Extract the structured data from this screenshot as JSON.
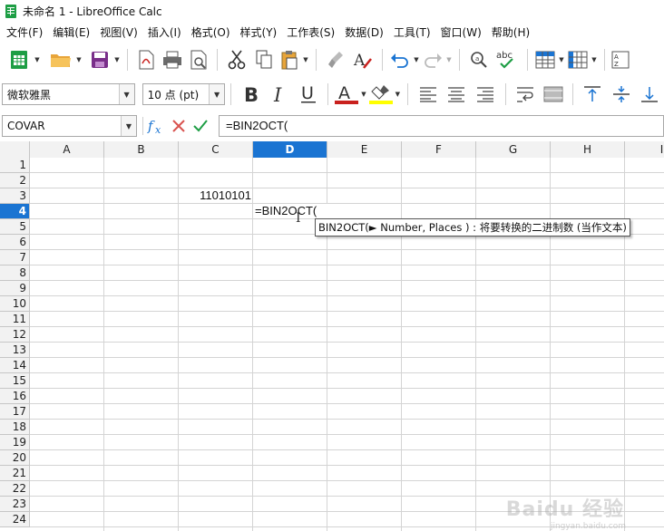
{
  "window": {
    "title": "未命名 1 - LibreOffice Calc"
  },
  "menu": [
    "文件(F)",
    "编辑(E)",
    "视图(V)",
    "插入(I)",
    "格式(O)",
    "样式(Y)",
    "工作表(S)",
    "数据(D)",
    "工具(T)",
    "窗口(W)",
    "帮助(H)"
  ],
  "format_bar": {
    "font_name": "微软雅黑",
    "font_size": "10 点 (pt)"
  },
  "formula_bar": {
    "name_box": "COVAR",
    "input": "=BIN2OCT("
  },
  "sheet": {
    "columns": [
      "A",
      "B",
      "C",
      "D",
      "E",
      "F",
      "G",
      "H",
      "I"
    ],
    "active_column": "D",
    "rows": [
      "1",
      "2",
      "3",
      "4",
      "5",
      "6",
      "7",
      "8",
      "9",
      "10",
      "11",
      "12",
      "13",
      "14",
      "15",
      "16",
      "17",
      "18",
      "19",
      "20",
      "21",
      "22",
      "23",
      "24"
    ],
    "active_row": "4",
    "cells": {
      "C3": "11010101",
      "D4": "=BIN2OCT("
    }
  },
  "tooltip": "BIN2OCT(► Number, Places ) : 将要转换的二进制数 (当作文本)",
  "watermark": {
    "brand": "Baidu 经验",
    "url": "jingyan.baidu.com"
  },
  "colors": {
    "accent": "#1a74d2",
    "font_color": "#c9211e",
    "highlight": "#ffff00",
    "app_green": "#1e9e45"
  }
}
